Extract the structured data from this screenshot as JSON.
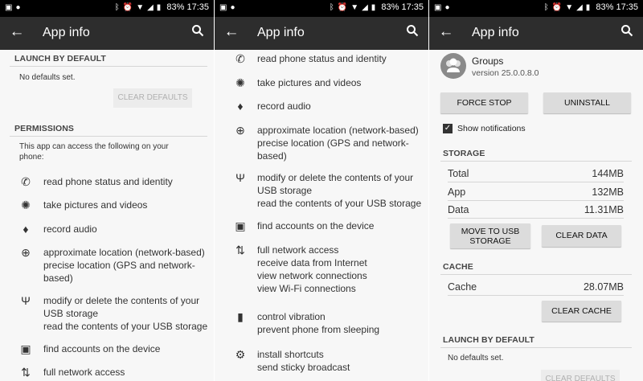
{
  "status_bar": {
    "battery": "83%",
    "time": "17:35"
  },
  "app_bar": {
    "title": "App info"
  },
  "panel1": {
    "launch_by_default": {
      "header": "LAUNCH BY DEFAULT",
      "text": "No defaults set.",
      "clear_button": "CLEAR DEFAULTS"
    },
    "permissions": {
      "header": "PERMISSIONS",
      "intro_line1": "This app can access the following on your",
      "intro_line2": "phone:",
      "items": [
        {
          "icon": "phone-icon",
          "lines": [
            "read phone status and identity"
          ]
        },
        {
          "icon": "camera-icon",
          "lines": [
            "take pictures and videos"
          ]
        },
        {
          "icon": "mic-icon",
          "lines": [
            "record audio"
          ]
        },
        {
          "icon": "location-icon",
          "lines": [
            "approximate location (network-based)",
            "precise location (GPS and network-",
            "based)"
          ]
        },
        {
          "icon": "usb-icon",
          "lines": [
            "modify or delete the contents of your",
            "USB storage",
            "read the contents of your USB storage"
          ]
        },
        {
          "icon": "account-icon",
          "lines": [
            "find accounts on the device"
          ]
        },
        {
          "icon": "network-icon",
          "lines": [
            "full network access"
          ]
        }
      ]
    }
  },
  "panel2": {
    "items": [
      {
        "icon": "phone-icon",
        "lines": [
          "read phone status and identity"
        ]
      },
      {
        "icon": "camera-icon",
        "lines": [
          "take pictures and videos"
        ]
      },
      {
        "icon": "mic-icon",
        "lines": [
          "record audio"
        ]
      },
      {
        "icon": "location-icon",
        "lines": [
          "approximate location (network-based)",
          "precise location (GPS and network-",
          "based)"
        ]
      },
      {
        "icon": "usb-icon",
        "lines": [
          "modify or delete the contents of your",
          "USB storage",
          "read the contents of your USB storage"
        ]
      },
      {
        "icon": "account-icon",
        "lines": [
          "find accounts on the device"
        ]
      },
      {
        "icon": "network-icon",
        "lines": [
          "full network access",
          "receive data from Internet",
          "view network connections",
          "view Wi-Fi connections"
        ]
      },
      {
        "icon": "battery-icon",
        "lines": [
          "control vibration",
          "prevent phone from sleeping"
        ]
      },
      {
        "icon": "settings-icon",
        "lines": [
          "install shortcuts",
          "send sticky broadcast"
        ]
      }
    ]
  },
  "panel3": {
    "app_name": "Groups",
    "version": "version 25.0.0.8.0",
    "force_stop": "FORCE STOP",
    "uninstall": "UNINSTALL",
    "show_notifications": "Show notifications",
    "storage": {
      "header": "STORAGE",
      "rows": [
        {
          "label": "Total",
          "value": "144MB"
        },
        {
          "label": "App",
          "value": "132MB"
        },
        {
          "label": "Data",
          "value": "11.31MB"
        }
      ],
      "move_button_line1": "MOVE TO USB",
      "move_button_line2": "STORAGE",
      "clear_data": "CLEAR DATA"
    },
    "cache": {
      "header": "CACHE",
      "label": "Cache",
      "value": "28.07MB",
      "clear_cache": "CLEAR CACHE"
    },
    "launch_by_default": {
      "header": "LAUNCH BY DEFAULT",
      "text": "No defaults set.",
      "clear_button": "CLEAR DEFAULTS"
    }
  }
}
